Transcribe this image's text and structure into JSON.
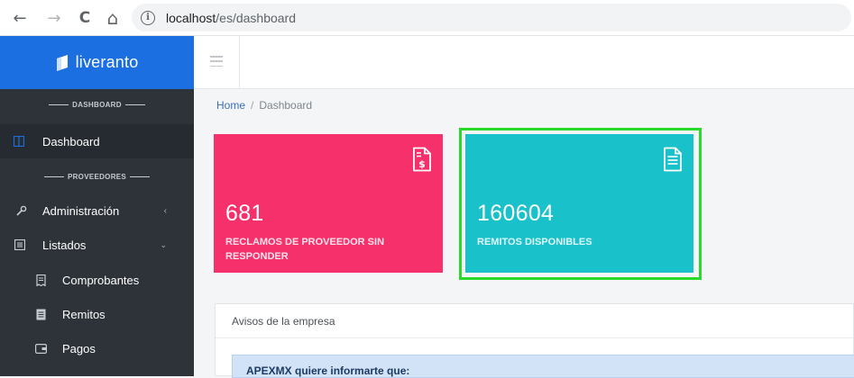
{
  "browser": {
    "url_host": "localhost",
    "url_path": "/es/dashboard",
    "back_icon": "←",
    "forward_icon": "→",
    "reload_icon": "C",
    "home_icon": "⌂",
    "info_icon": "i"
  },
  "brand": {
    "name": "liveranto"
  },
  "sidebar": {
    "section_dashboard": "DASHBOARD",
    "section_proveedores": "PROVEEDORES",
    "items": [
      {
        "label": "Dashboard",
        "icon": "columns-icon"
      },
      {
        "label": "Administración",
        "icon": "wrench-icon"
      },
      {
        "label": "Listados",
        "icon": "list-icon"
      },
      {
        "label": "Comprobantes",
        "icon": "receipt-icon"
      },
      {
        "label": "Remitos",
        "icon": "document-icon"
      },
      {
        "label": "Pagos",
        "icon": "wallet-icon"
      }
    ]
  },
  "breadcrumb": {
    "home": "Home",
    "separator": "/",
    "current": "Dashboard"
  },
  "cards": [
    {
      "number": "681",
      "label": "RECLAMOS DE PROVEEDOR SIN RESPONDER",
      "color": "#f5306b",
      "icon": "invoice-dollar-icon"
    },
    {
      "number": "160604",
      "label": "REMITOS DISPONIBLES",
      "color": "#19c1ca",
      "icon": "file-text-icon"
    }
  ],
  "panel": {
    "title": "Avisos de la empresa",
    "notice": "APEXMX quiere informarte que:"
  },
  "colors": {
    "brand_blue": "#1c6fe0",
    "sidebar_bg": "#2d3338",
    "highlight_green": "#2bd92b"
  }
}
